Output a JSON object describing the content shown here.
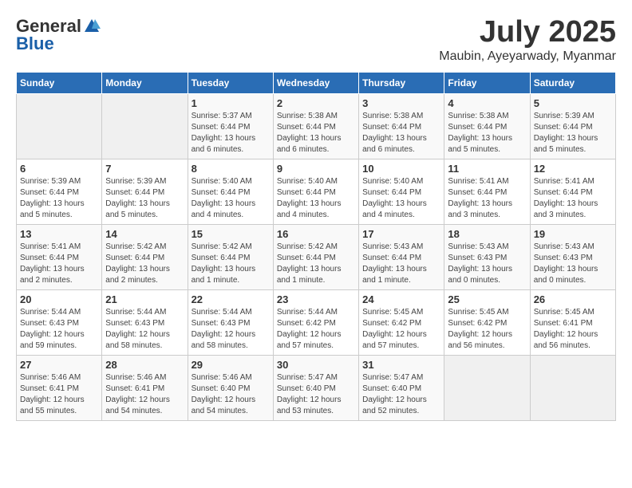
{
  "logo": {
    "general": "General",
    "blue": "Blue"
  },
  "header": {
    "month_year": "July 2025",
    "location": "Maubin, Ayeyarwady, Myanmar"
  },
  "days_of_week": [
    "Sunday",
    "Monday",
    "Tuesday",
    "Wednesday",
    "Thursday",
    "Friday",
    "Saturday"
  ],
  "weeks": [
    [
      {
        "day": "",
        "info": ""
      },
      {
        "day": "",
        "info": ""
      },
      {
        "day": "1",
        "info": "Sunrise: 5:37 AM\nSunset: 6:44 PM\nDaylight: 13 hours\nand 6 minutes."
      },
      {
        "day": "2",
        "info": "Sunrise: 5:38 AM\nSunset: 6:44 PM\nDaylight: 13 hours\nand 6 minutes."
      },
      {
        "day": "3",
        "info": "Sunrise: 5:38 AM\nSunset: 6:44 PM\nDaylight: 13 hours\nand 6 minutes."
      },
      {
        "day": "4",
        "info": "Sunrise: 5:38 AM\nSunset: 6:44 PM\nDaylight: 13 hours\nand 5 minutes."
      },
      {
        "day": "5",
        "info": "Sunrise: 5:39 AM\nSunset: 6:44 PM\nDaylight: 13 hours\nand 5 minutes."
      }
    ],
    [
      {
        "day": "6",
        "info": "Sunrise: 5:39 AM\nSunset: 6:44 PM\nDaylight: 13 hours\nand 5 minutes."
      },
      {
        "day": "7",
        "info": "Sunrise: 5:39 AM\nSunset: 6:44 PM\nDaylight: 13 hours\nand 5 minutes."
      },
      {
        "day": "8",
        "info": "Sunrise: 5:40 AM\nSunset: 6:44 PM\nDaylight: 13 hours\nand 4 minutes."
      },
      {
        "day": "9",
        "info": "Sunrise: 5:40 AM\nSunset: 6:44 PM\nDaylight: 13 hours\nand 4 minutes."
      },
      {
        "day": "10",
        "info": "Sunrise: 5:40 AM\nSunset: 6:44 PM\nDaylight: 13 hours\nand 4 minutes."
      },
      {
        "day": "11",
        "info": "Sunrise: 5:41 AM\nSunset: 6:44 PM\nDaylight: 13 hours\nand 3 minutes."
      },
      {
        "day": "12",
        "info": "Sunrise: 5:41 AM\nSunset: 6:44 PM\nDaylight: 13 hours\nand 3 minutes."
      }
    ],
    [
      {
        "day": "13",
        "info": "Sunrise: 5:41 AM\nSunset: 6:44 PM\nDaylight: 13 hours\nand 2 minutes."
      },
      {
        "day": "14",
        "info": "Sunrise: 5:42 AM\nSunset: 6:44 PM\nDaylight: 13 hours\nand 2 minutes."
      },
      {
        "day": "15",
        "info": "Sunrise: 5:42 AM\nSunset: 6:44 PM\nDaylight: 13 hours\nand 1 minute."
      },
      {
        "day": "16",
        "info": "Sunrise: 5:42 AM\nSunset: 6:44 PM\nDaylight: 13 hours\nand 1 minute."
      },
      {
        "day": "17",
        "info": "Sunrise: 5:43 AM\nSunset: 6:44 PM\nDaylight: 13 hours\nand 1 minute."
      },
      {
        "day": "18",
        "info": "Sunrise: 5:43 AM\nSunset: 6:43 PM\nDaylight: 13 hours\nand 0 minutes."
      },
      {
        "day": "19",
        "info": "Sunrise: 5:43 AM\nSunset: 6:43 PM\nDaylight: 13 hours\nand 0 minutes."
      }
    ],
    [
      {
        "day": "20",
        "info": "Sunrise: 5:44 AM\nSunset: 6:43 PM\nDaylight: 12 hours\nand 59 minutes."
      },
      {
        "day": "21",
        "info": "Sunrise: 5:44 AM\nSunset: 6:43 PM\nDaylight: 12 hours\nand 58 minutes."
      },
      {
        "day": "22",
        "info": "Sunrise: 5:44 AM\nSunset: 6:43 PM\nDaylight: 12 hours\nand 58 minutes."
      },
      {
        "day": "23",
        "info": "Sunrise: 5:44 AM\nSunset: 6:42 PM\nDaylight: 12 hours\nand 57 minutes."
      },
      {
        "day": "24",
        "info": "Sunrise: 5:45 AM\nSunset: 6:42 PM\nDaylight: 12 hours\nand 57 minutes."
      },
      {
        "day": "25",
        "info": "Sunrise: 5:45 AM\nSunset: 6:42 PM\nDaylight: 12 hours\nand 56 minutes."
      },
      {
        "day": "26",
        "info": "Sunrise: 5:45 AM\nSunset: 6:41 PM\nDaylight: 12 hours\nand 56 minutes."
      }
    ],
    [
      {
        "day": "27",
        "info": "Sunrise: 5:46 AM\nSunset: 6:41 PM\nDaylight: 12 hours\nand 55 minutes."
      },
      {
        "day": "28",
        "info": "Sunrise: 5:46 AM\nSunset: 6:41 PM\nDaylight: 12 hours\nand 54 minutes."
      },
      {
        "day": "29",
        "info": "Sunrise: 5:46 AM\nSunset: 6:40 PM\nDaylight: 12 hours\nand 54 minutes."
      },
      {
        "day": "30",
        "info": "Sunrise: 5:47 AM\nSunset: 6:40 PM\nDaylight: 12 hours\nand 53 minutes."
      },
      {
        "day": "31",
        "info": "Sunrise: 5:47 AM\nSunset: 6:40 PM\nDaylight: 12 hours\nand 52 minutes."
      },
      {
        "day": "",
        "info": ""
      },
      {
        "day": "",
        "info": ""
      }
    ]
  ]
}
